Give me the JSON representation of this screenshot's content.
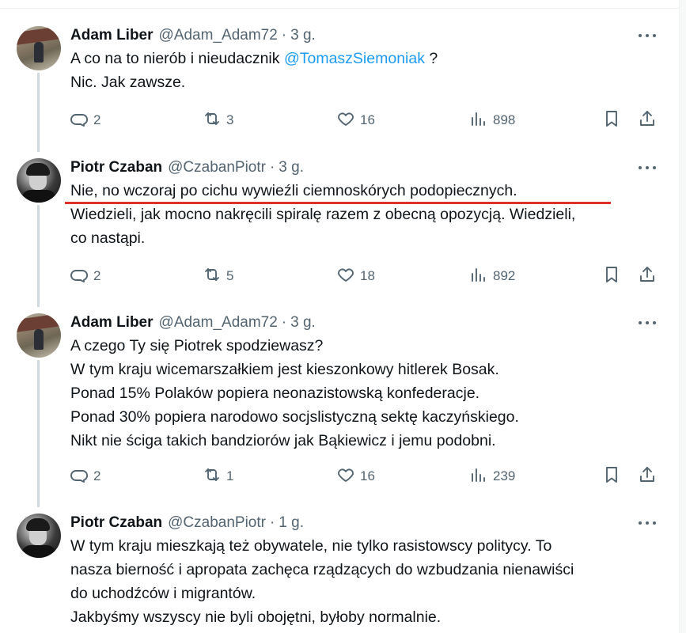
{
  "tweets": [
    {
      "avatar": "adam",
      "name": "Adam Liber",
      "handle": "@Adam_Adam72",
      "time": "3 g.",
      "lines": [
        [
          {
            "t": "A co na to nierób i nieudacznik "
          },
          {
            "t": "@TomaszSiemoniak",
            "mention": true
          },
          {
            "t": " ?"
          }
        ],
        [
          {
            "t": "Nic. Jak zawsze."
          }
        ]
      ],
      "replies": "2",
      "retweets": "3",
      "likes": "16",
      "views": "898"
    },
    {
      "avatar": "piotr",
      "name": "Piotr Czaban",
      "handle": "@CzabanPiotr",
      "time": "3 g.",
      "lines": [
        [
          {
            "t": "Nie, no wczoraj po cichu wywieźli ciemnoskórych podopiecznych."
          }
        ],
        [
          {
            "t": "Wiedzieli, jak mocno nakręcili spiralę razem z obecną opozycją. Wiedzieli,"
          }
        ],
        [
          {
            "t": "co nastąpi."
          }
        ]
      ],
      "replies": "2",
      "retweets": "5",
      "likes": "18",
      "views": "892"
    },
    {
      "avatar": "adam",
      "name": "Adam Liber",
      "handle": "@Adam_Adam72",
      "time": "3 g.",
      "lines": [
        [
          {
            "t": "A czego Ty się Piotrek spodziewasz?"
          }
        ],
        [
          {
            "t": "W tym kraju wicemarszałkiem jest kieszonkowy hitlerek Bosak."
          }
        ],
        [
          {
            "t": "Ponad 15% Polaków popiera neonazistowską konfederacje."
          }
        ],
        [
          {
            "t": "Ponad 30% popiera narodowo socjslistyczną sektę kaczyńskiego."
          }
        ],
        [
          {
            "t": "Nikt nie ściga takich bandziorów jak Bąkiewicz i jemu podobni."
          }
        ]
      ],
      "replies": "2",
      "retweets": "1",
      "likes": "16",
      "views": "239"
    },
    {
      "avatar": "piotr",
      "name": "Piotr Czaban",
      "handle": "@CzabanPiotr",
      "time": "1 g.",
      "lines": [
        [
          {
            "t": "W tym kraju mieszkają też obywatele, nie tylko rasistowscy politycy. To"
          }
        ],
        [
          {
            "t": "nasza bierność i apropata zachęca rządzących do wzbudzania nienawiści"
          }
        ],
        [
          {
            "t": "do uchodźców i migrantów."
          }
        ],
        [
          {
            "t": "Jakbyśmy wszyscy nie byli obojętni, byłoby normalnie."
          }
        ]
      ],
      "replies": "",
      "retweets": "",
      "likes": "",
      "views": ""
    }
  ],
  "icons": {
    "reply": "reply-icon",
    "retweet": "retweet-icon",
    "like": "heart-icon",
    "views": "views-icon",
    "bookmark": "bookmark-icon",
    "share": "share-icon",
    "more": "more-icon"
  },
  "colors": {
    "mention": "#1d9bf0",
    "underline": "#e0302a",
    "muted": "#536471"
  }
}
